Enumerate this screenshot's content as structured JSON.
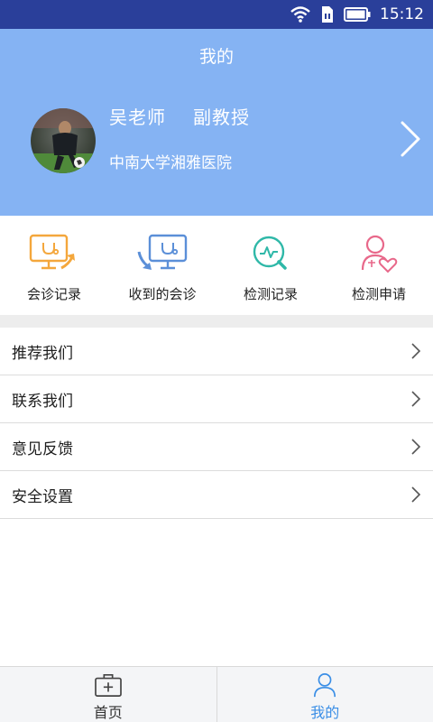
{
  "status_bar": {
    "time": "15:12",
    "icons": [
      "wifi-icon",
      "sim-icon",
      "battery-icon"
    ]
  },
  "header": {
    "title": "我的",
    "background_color": "#85b3f3"
  },
  "profile": {
    "name": "吴老师",
    "title": "副教授",
    "hospital": "中南大学湘雅医院",
    "avatar": "avatar-photo"
  },
  "quick_actions": [
    {
      "label": "会诊记录",
      "icon": "consultation-record-icon"
    },
    {
      "label": "收到的会诊",
      "icon": "received-consultation-icon"
    },
    {
      "label": "检测记录",
      "icon": "test-record-icon"
    },
    {
      "label": "检测申请",
      "icon": "test-request-icon"
    }
  ],
  "menu": [
    {
      "label": "推荐我们"
    },
    {
      "label": "联系我们"
    },
    {
      "label": "意见反馈"
    },
    {
      "label": "安全设置"
    }
  ],
  "tabbar": {
    "home_label": "首页",
    "mine_label": "我的",
    "active_tab": "我的",
    "active_color": "#3a8ee6"
  }
}
